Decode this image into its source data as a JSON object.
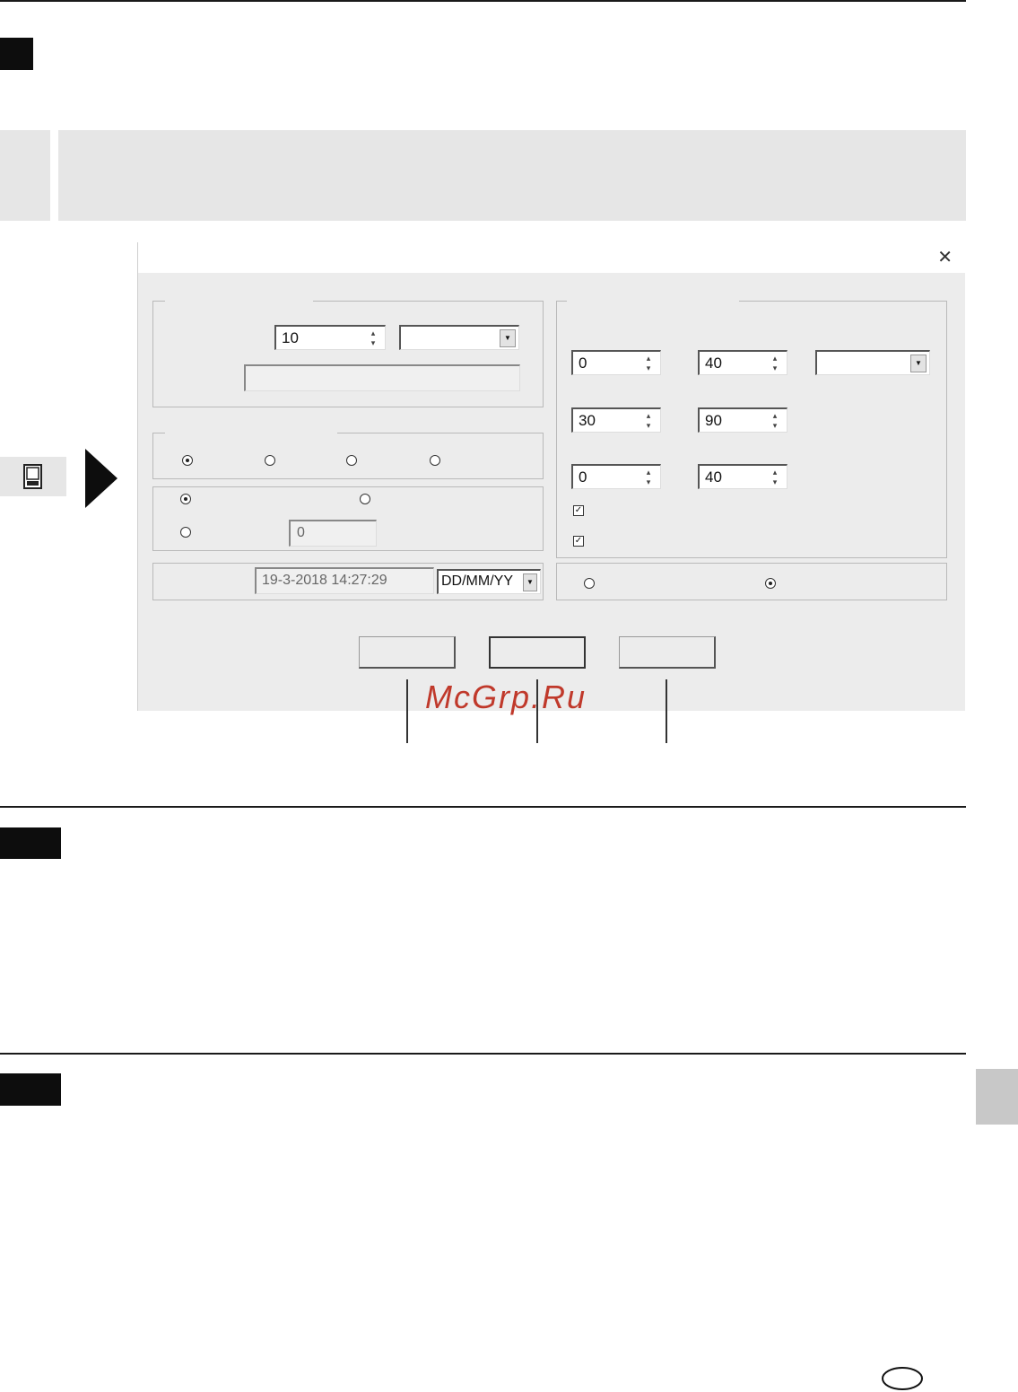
{
  "dialog": {
    "close_glyph": "✕",
    "counter_value": "10",
    "timestamp_value": "19-3-2018 14:27:29",
    "date_format": "DD/MM/YY",
    "offset_value": "0",
    "spin_values": {
      "r1c1": "0",
      "r1c2": "40",
      "r2c1": "30",
      "r2c2": "90",
      "r3c1": "0",
      "r3c2": "40"
    },
    "checkbox_mark": "✓"
  },
  "watermark": {
    "text": "McGrp.Ru",
    "color": "#c0392b"
  },
  "icons": {
    "arrow": "black-triangle-right",
    "panel": "window-panel-icon"
  }
}
